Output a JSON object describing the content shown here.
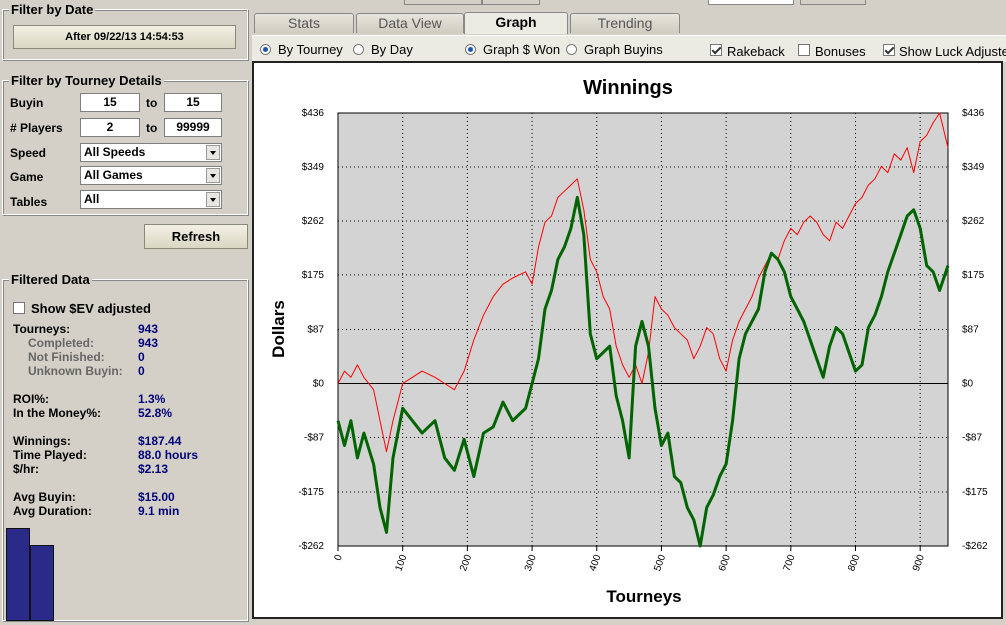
{
  "filter_by_date": {
    "title": "Filter by Date",
    "date_button": "After 09/22/13 14:54:53"
  },
  "tourney_details": {
    "title": "Filter by Tourney Details",
    "buyin_label": "Buyin",
    "buyin_min": "15",
    "buyin_to": "to",
    "buyin_max": "15",
    "players_label": "# Players",
    "players_min": "2",
    "players_to": "to",
    "players_max": "99999",
    "speed_label": "Speed",
    "speed_value": "All Speeds",
    "game_label": "Game",
    "game_value": "All Games",
    "tables_label": "Tables",
    "tables_value": "All"
  },
  "refresh_button": "Refresh",
  "filtered_data": {
    "title": "Filtered Data",
    "ev_label": "Show $EV adjusted",
    "stats": [
      {
        "label": "Tourneys:",
        "value": "943",
        "sub": false
      },
      {
        "label": "Completed:",
        "value": "943",
        "sub": true
      },
      {
        "label": "Not Finished:",
        "value": "0",
        "sub": true
      },
      {
        "label": "Unknown Buyin:",
        "value": "0",
        "sub": true
      },
      {
        "label": "ROI%:",
        "value": "1.3%",
        "sub": false
      },
      {
        "label": "In the Money%:",
        "value": "52.8%",
        "sub": false
      },
      {
        "label": "Winnings:",
        "value": "$187.44",
        "sub": false
      },
      {
        "label": "Time Played:",
        "value": "88.0 hours",
        "sub": false
      },
      {
        "label": "$/hr:",
        "value": "$2.13",
        "sub": false
      },
      {
        "label": "Avg Buyin:",
        "value": "$15.00",
        "sub": false
      },
      {
        "label": "Avg Duration:",
        "value": "9.1 min",
        "sub": false
      }
    ]
  },
  "tabs": [
    "Stats",
    "Data View",
    "Graph",
    "Trending"
  ],
  "active_tab": "Graph",
  "options": {
    "by_tourney": "By Tourney",
    "by_day": "By Day",
    "graph_won": "Graph $ Won",
    "graph_buyins": "Graph Buyins",
    "rakeback": "Rakeback",
    "bonuses": "Bonuses",
    "show_luck": "Show Luck Adjuste"
  },
  "colors": {
    "winnings_line": "#ff0000",
    "luck_line": "#006400",
    "plot_bg": "#d3d3d3",
    "stat_values": "#00007a",
    "mini_bar": "#2a2a88"
  },
  "chart_data": {
    "type": "line",
    "title": "Winnings",
    "xlabel": "Tourneys",
    "ylabel": "Dollars",
    "xlim": [
      0,
      943
    ],
    "ylim": [
      -262,
      436
    ],
    "x_ticks": [
      0,
      100,
      200,
      300,
      400,
      500,
      600,
      700,
      800,
      900
    ],
    "y_ticks": [
      -262,
      -175,
      -87,
      0,
      87,
      175,
      262,
      349,
      436
    ],
    "y_tick_labels": [
      "-$262",
      "-$175",
      "-$87",
      "$0",
      "$87",
      "$175",
      "$262",
      "$349",
      "$436"
    ],
    "grid": true,
    "series": [
      {
        "color": "#ff0000",
        "x": [
          0,
          10,
          20,
          30,
          40,
          55,
          65,
          75,
          85,
          100,
          115,
          130,
          150,
          165,
          180,
          195,
          210,
          225,
          240,
          255,
          270,
          280,
          290,
          300,
          310,
          320,
          330,
          340,
          350,
          360,
          370,
          380,
          390,
          400,
          410,
          420,
          430,
          440,
          450,
          460,
          470,
          480,
          490,
          500,
          510,
          520,
          530,
          540,
          550,
          560,
          570,
          580,
          590,
          600,
          610,
          620,
          630,
          640,
          650,
          660,
          670,
          680,
          690,
          700,
          710,
          720,
          730,
          740,
          750,
          760,
          770,
          780,
          790,
          800,
          810,
          820,
          830,
          840,
          850,
          860,
          870,
          880,
          890,
          900,
          910,
          920,
          930,
          943
        ],
        "y": [
          0,
          20,
          10,
          30,
          10,
          -10,
          -60,
          -110,
          -60,
          0,
          10,
          20,
          10,
          0,
          -10,
          20,
          70,
          110,
          140,
          160,
          170,
          175,
          180,
          160,
          220,
          260,
          270,
          300,
          310,
          320,
          330,
          280,
          200,
          180,
          140,
          120,
          60,
          30,
          10,
          30,
          0,
          50,
          140,
          120,
          110,
          90,
          80,
          70,
          40,
          60,
          90,
          80,
          40,
          20,
          70,
          100,
          120,
          140,
          170,
          190,
          210,
          200,
          230,
          250,
          240,
          260,
          270,
          260,
          240,
          230,
          260,
          250,
          270,
          290,
          300,
          320,
          330,
          350,
          340,
          370,
          360,
          380,
          340,
          390,
          400,
          420,
          436,
          380
        ]
      },
      {
        "color": "#006400",
        "x": [
          0,
          10,
          20,
          30,
          40,
          55,
          65,
          75,
          85,
          100,
          115,
          130,
          150,
          165,
          180,
          195,
          210,
          225,
          240,
          255,
          270,
          280,
          290,
          300,
          310,
          320,
          330,
          340,
          350,
          360,
          370,
          380,
          390,
          400,
          410,
          420,
          430,
          440,
          450,
          460,
          470,
          480,
          490,
          500,
          510,
          520,
          530,
          540,
          550,
          560,
          570,
          580,
          590,
          600,
          610,
          620,
          630,
          640,
          650,
          660,
          670,
          680,
          690,
          700,
          710,
          720,
          730,
          740,
          750,
          760,
          770,
          780,
          790,
          800,
          810,
          820,
          830,
          840,
          850,
          860,
          870,
          880,
          890,
          900,
          910,
          920,
          930,
          943
        ],
        "y": [
          -60,
          -100,
          -60,
          -120,
          -80,
          -130,
          -200,
          -240,
          -120,
          -40,
          -60,
          -80,
          -60,
          -120,
          -140,
          -90,
          -150,
          -80,
          -70,
          -30,
          -60,
          -50,
          -40,
          0,
          40,
          120,
          150,
          200,
          220,
          250,
          300,
          240,
          80,
          40,
          50,
          60,
          -20,
          -60,
          -120,
          60,
          100,
          60,
          -40,
          -100,
          -80,
          -150,
          -160,
          -200,
          -220,
          -262,
          -200,
          -180,
          -150,
          -130,
          -60,
          40,
          80,
          100,
          120,
          180,
          210,
          200,
          180,
          140,
          120,
          100,
          70,
          40,
          10,
          60,
          90,
          80,
          50,
          20,
          30,
          90,
          110,
          140,
          180,
          210,
          240,
          270,
          280,
          250,
          190,
          180,
          150,
          190
        ]
      }
    ]
  }
}
